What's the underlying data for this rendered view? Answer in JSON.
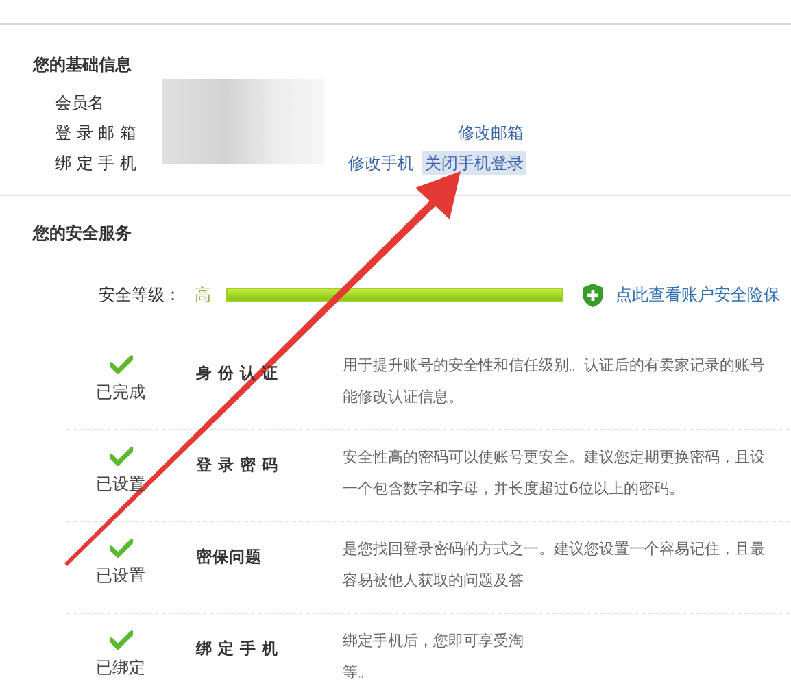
{
  "basic_info": {
    "title": "您的基础信息",
    "fields": [
      {
        "label": "会员名"
      },
      {
        "label": "登 录 邮 箱",
        "links": [
          {
            "text": "修改邮箱",
            "selected": false
          }
        ]
      },
      {
        "label": "绑 定 手 机",
        "links": [
          {
            "text": "修改手机",
            "selected": false
          },
          {
            "text": "关闭手机登录",
            "selected": true
          }
        ]
      }
    ]
  },
  "security": {
    "title": "您的安全服务",
    "level_label": "安全等级：",
    "level_text": "高",
    "level": 1,
    "insurance_link": "点此查看账户安全险保",
    "items": [
      {
        "status": "已完成",
        "name": "身 份 认 证",
        "description": [
          "用于提升账号的安全性和信任级别。认证后的有卖家记录的账号",
          "能修改认证信息。"
        ]
      },
      {
        "status": "已设置",
        "name": "登 录 密 码",
        "description": [
          "安全性高的密码可以使账号更安全。建议您定期更换密码，且设",
          "一个包含数字和字母，并长度超过6位以上的密码。"
        ]
      },
      {
        "status": "已设置",
        "name": "密保问题",
        "description": [
          "是您找回登录密码的方式之一。建议您设置一个容易记住，且最",
          "容易被他人获取的问题及答"
        ]
      },
      {
        "status": "已绑定",
        "name": "绑 定 手 机",
        "description": [
          "绑定手机后，您即可享受淘",
          "等。"
        ]
      }
    ]
  }
}
